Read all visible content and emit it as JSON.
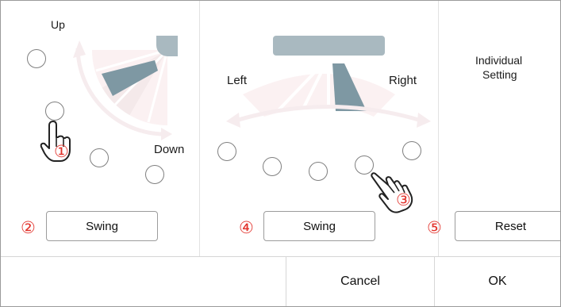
{
  "vertical_panel": {
    "up_label": "Up",
    "down_label": "Down",
    "swing_label": "Swing",
    "marker_1": "①",
    "marker_2": "②"
  },
  "horizontal_panel": {
    "left_label": "Left",
    "right_label": "Right",
    "swing_label": "Swing",
    "marker_3": "③",
    "marker_4": "④"
  },
  "individual_panel": {
    "title_line1": "Individual",
    "title_line2": "Setting",
    "reset_label": "Reset",
    "marker_5": "⑤"
  },
  "footer": {
    "cancel_label": "Cancel",
    "ok_label": "OK"
  },
  "icons": {
    "vane": "vane-blade-icon",
    "pointer": "pointing-hand-icon"
  },
  "colors": {
    "accent_red": "#e2322b",
    "vane_active": "#7e98a3",
    "vane_unit": "#a9b9c0",
    "fan_shade": "#fbf1f2"
  }
}
